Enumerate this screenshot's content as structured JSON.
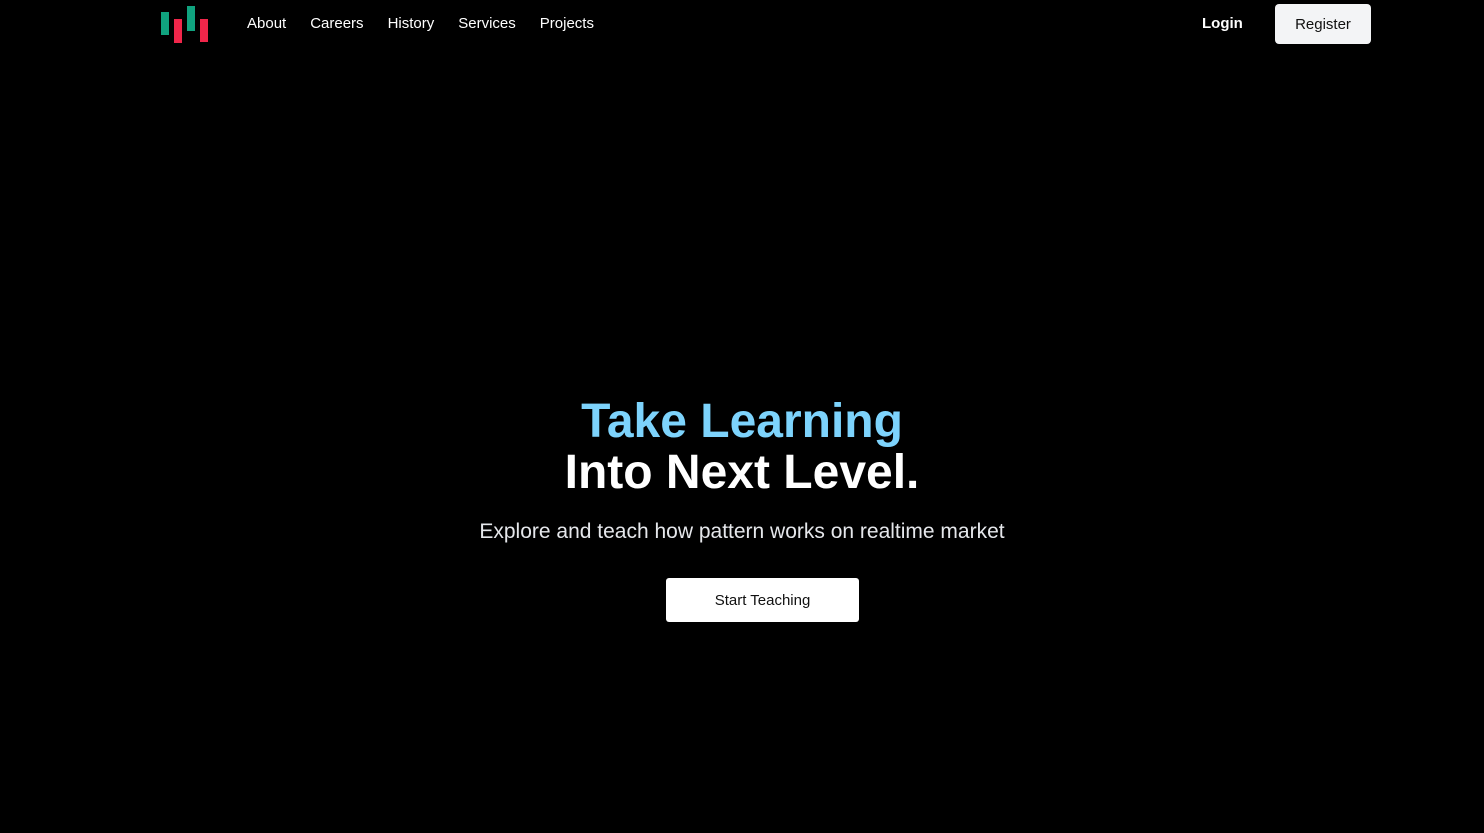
{
  "nav": {
    "logo_icon": "candlestick-chart-logo",
    "links": [
      "About",
      "Careers",
      "History",
      "Services",
      "Projects"
    ],
    "login_label": "Login",
    "register_label": "Register"
  },
  "hero": {
    "line1": "Take Learning",
    "line2": "Into Next Level.",
    "subtitle": "Explore and teach how pattern works on realtime market",
    "cta_label": "Start Teaching"
  },
  "colors": {
    "background": "#000000",
    "accent": "#7dd3fc",
    "logo_green": "#10a37f",
    "logo_red": "#f0264a"
  }
}
